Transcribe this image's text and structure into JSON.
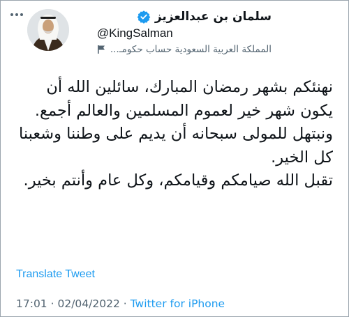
{
  "author": {
    "display_name": "سلمان بن عبدالعزيز",
    "handle": "@KingSalman",
    "affiliation_label": "المملكة العربية السعودية حساب حكومـ..."
  },
  "tweet": {
    "paragraphs": [
      "نهنئكم بشهر رمضان المبارك، سائلين الله أن يكون شهر خير لعموم المسلمين والعالم أجمع.",
      "ونبتهل للمولى سبحانه أن يديم على وطننا وشعبنا كل الخير.",
      "تقبل الله صيامكم وقيامكم، وكل عام وأنتم بخير."
    ],
    "translate_label": "Translate Tweet"
  },
  "meta": {
    "time": "17:01",
    "date": "02/04/2022",
    "separator": "·",
    "source": "Twitter for iPhone"
  },
  "icons": {
    "more": "more-horizontal-icon",
    "verified": "verified-badge-icon",
    "flag": "flag-icon"
  },
  "colors": {
    "verified_blue": "#1d9bf0",
    "link_blue": "#1d9bf0",
    "secondary_text": "#536471",
    "primary_text": "#0f1419"
  }
}
